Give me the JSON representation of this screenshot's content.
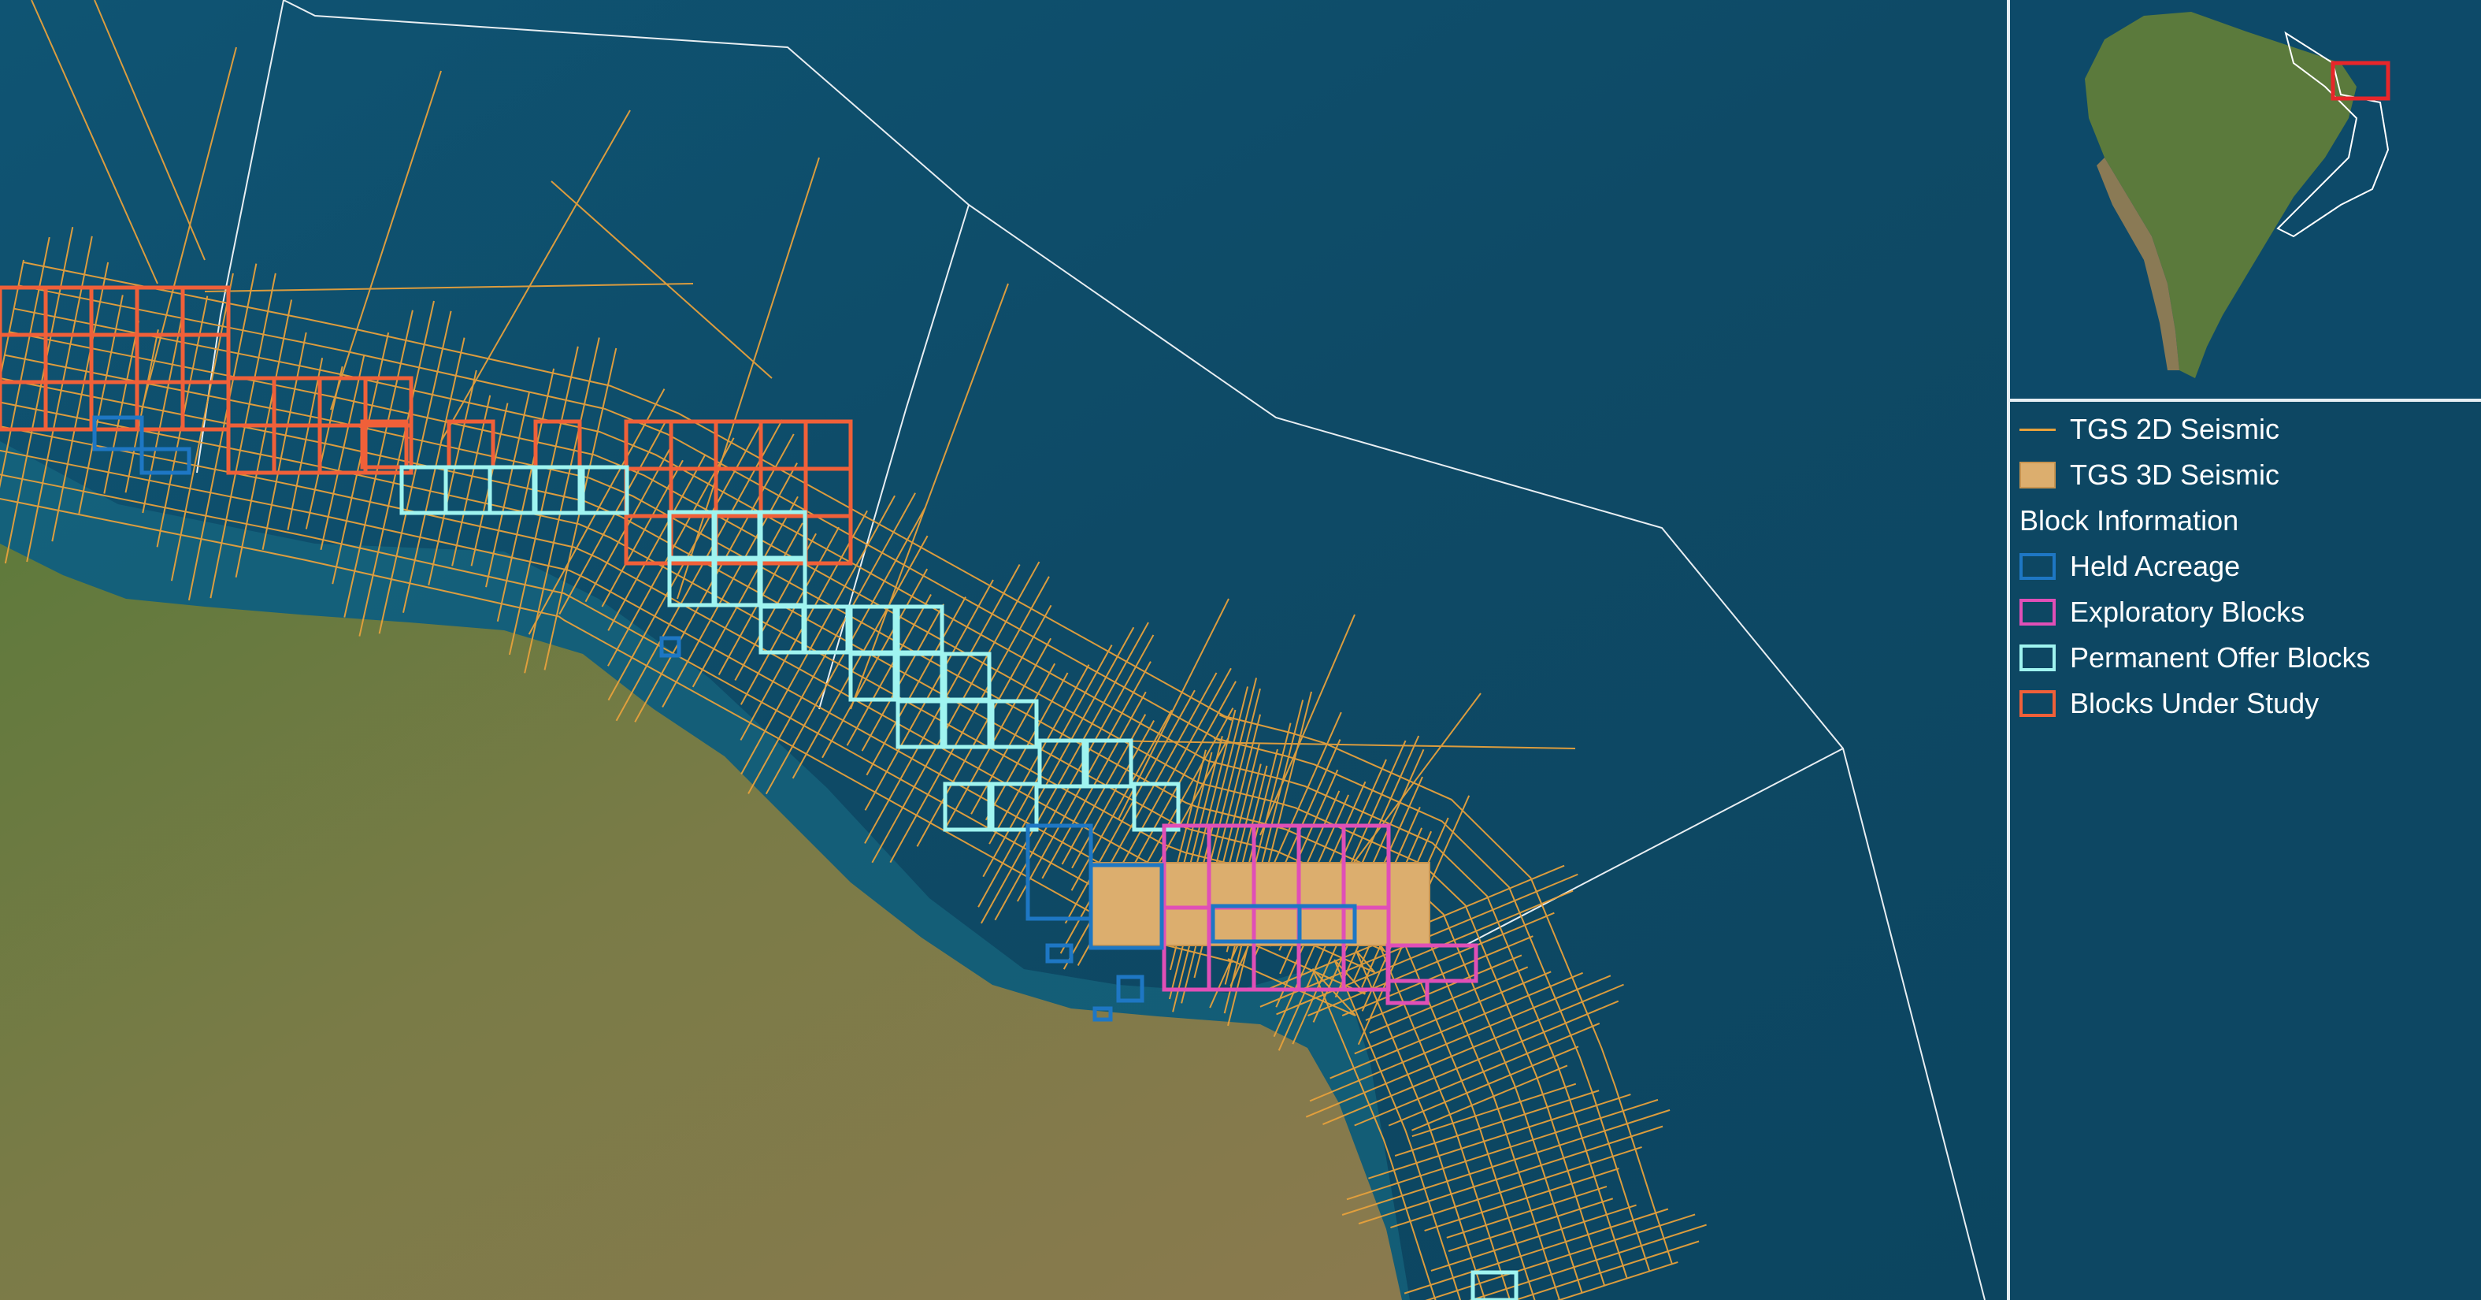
{
  "legend": {
    "tgs_2d": "TGS 2D Seismic",
    "tgs_3d": "TGS 3D Seismic",
    "block_info_heading": "Block Information",
    "held": "Held Acreage",
    "exploratory": "Exploratory Blocks",
    "permanent": "Permanent Offer Blocks",
    "under_study": "Blocks Under Study"
  },
  "colors": {
    "ocean": "#0e4a66",
    "land": "#6e7b43",
    "seismic_2d": "#e7a13c",
    "seismic_3d": "#dcae6e",
    "held_acreage": "#1e77c4",
    "exploratory_blocks": "#e04fb7",
    "permanent_offer_blocks": "#9ff4f0",
    "blocks_under_study": "#f06039",
    "inset_highlight": "#e8262a"
  },
  "icons": {
    "seismic_2d": "orange-line-icon",
    "seismic_3d": "tan-filled-square-icon",
    "held": "blue-outline-square-icon",
    "exploratory": "magenta-outline-square-icon",
    "permanent": "cyan-outline-square-icon",
    "under_study": "orange-red-outline-square-icon"
  }
}
